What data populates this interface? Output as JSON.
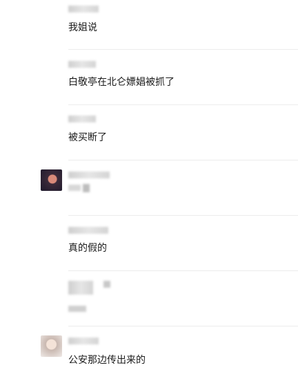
{
  "comments": [
    {
      "text": "我姐说"
    },
    {
      "text": "白敬亭在北仑嫖娼被抓了"
    },
    {
      "text": "被买断了"
    },
    {
      "text": ""
    },
    {
      "text": "真的假的"
    },
    {
      "text": ""
    },
    {
      "text": "公安那边传出来的"
    }
  ],
  "avatar_colors": {
    "dark": "#1e1a2c",
    "light": "#efe9e6"
  }
}
